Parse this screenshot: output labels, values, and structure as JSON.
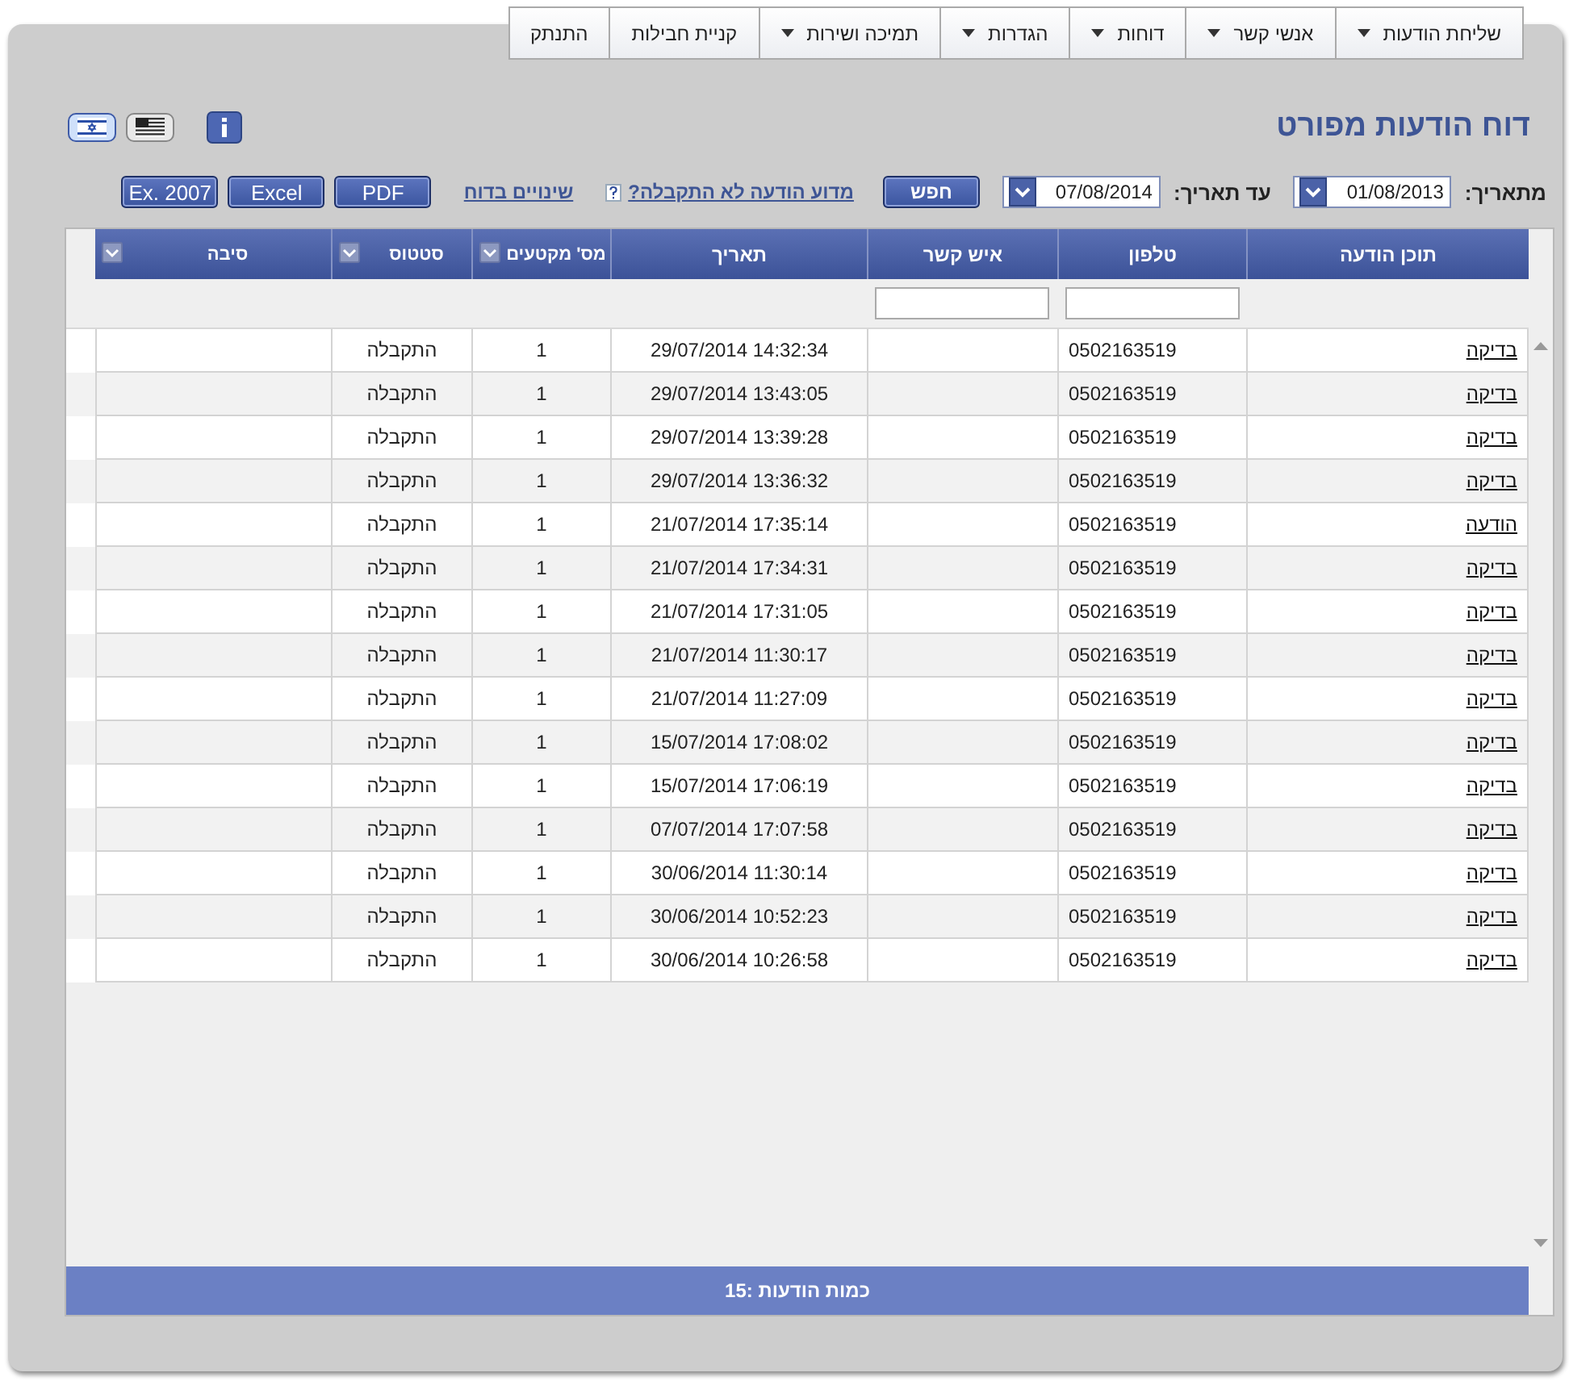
{
  "menu": [
    {
      "label": "שליחת הודעות",
      "dropdown": true
    },
    {
      "label": "אנשי קשר",
      "dropdown": true
    },
    {
      "label": "דוחות",
      "dropdown": true
    },
    {
      "label": "הגדרות",
      "dropdown": true
    },
    {
      "label": "תמיכה ושירות",
      "dropdown": true
    },
    {
      "label": "קניית חבילות",
      "dropdown": false
    },
    {
      "label": "התנתק",
      "dropdown": false
    }
  ],
  "title": "דוח הודעות מפורט",
  "languages": [
    {
      "kind": "usa",
      "selected": false
    },
    {
      "kind": "israel",
      "selected": true
    }
  ],
  "filters": {
    "from_label": "מתאריך:",
    "from_value": "01/08/2013",
    "to_label": "עד תאריך:",
    "to_value": "07/08/2014",
    "search_button": "חפש",
    "why_link": "מדוע הודעה לא התקבלה?",
    "changes_link": "שינויים בדוח",
    "export_buttons": [
      "PDF",
      "Excel",
      "Ex. 2007"
    ]
  },
  "table": {
    "columns": [
      {
        "label": "תוכן הודעה",
        "menu": false
      },
      {
        "label": "טלפון",
        "menu": false
      },
      {
        "label": "איש קשר",
        "menu": false
      },
      {
        "label": "תאריך",
        "menu": false
      },
      {
        "label": "מס' מקטעים",
        "menu": true
      },
      {
        "label": "סטטוס",
        "menu": true
      },
      {
        "label": "סיבה",
        "menu": true
      }
    ],
    "filter_row": [
      {
        "kind": "empty"
      },
      {
        "kind": "input"
      },
      {
        "kind": "input"
      },
      {
        "kind": "empty"
      },
      {
        "kind": "empty"
      },
      {
        "kind": "empty"
      },
      {
        "kind": "empty"
      }
    ],
    "rows": [
      [
        "בדיקה",
        "0502163519",
        "",
        "29/07/2014 14:32:34",
        "1",
        "התקבלה",
        ""
      ],
      [
        "בדיקה",
        "0502163519",
        "",
        "29/07/2014 13:43:05",
        "1",
        "התקבלה",
        ""
      ],
      [
        "בדיקה",
        "0502163519",
        "",
        "29/07/2014 13:39:28",
        "1",
        "התקבלה",
        ""
      ],
      [
        "בדיקה",
        "0502163519",
        "",
        "29/07/2014 13:36:32",
        "1",
        "התקבלה",
        ""
      ],
      [
        "הודעה",
        "0502163519",
        "",
        "21/07/2014 17:35:14",
        "1",
        "התקבלה",
        ""
      ],
      [
        "בדיקה",
        "0502163519",
        "",
        "21/07/2014 17:34:31",
        "1",
        "התקבלה",
        ""
      ],
      [
        "בדיקה",
        "0502163519",
        "",
        "21/07/2014 17:31:05",
        "1",
        "התקבלה",
        ""
      ],
      [
        "בדיקה",
        "0502163519",
        "",
        "21/07/2014 11:30:17",
        "1",
        "התקבלה",
        ""
      ],
      [
        "בדיקה",
        "0502163519",
        "",
        "21/07/2014 11:27:09",
        "1",
        "התקבלה",
        ""
      ],
      [
        "בדיקה",
        "0502163519",
        "",
        "15/07/2014 17:08:02",
        "1",
        "התקבלה",
        ""
      ],
      [
        "בדיקה",
        "0502163519",
        "",
        "15/07/2014 17:06:19",
        "1",
        "התקבלה",
        ""
      ],
      [
        "בדיקה",
        "0502163519",
        "",
        "07/07/2014 17:07:58",
        "1",
        "התקבלה",
        ""
      ],
      [
        "בדיקה",
        "0502163519",
        "",
        "30/06/2014 11:30:14",
        "1",
        "התקבלה",
        ""
      ],
      [
        "בדיקה",
        "0502163519",
        "",
        "30/06/2014 10:52:23",
        "1",
        "התקבלה",
        ""
      ],
      [
        "בדיקה",
        "0502163519",
        "",
        "30/06/2014 10:26:58",
        "1",
        "התקבלה",
        ""
      ]
    ],
    "footer": "כמות הודעות :15"
  }
}
